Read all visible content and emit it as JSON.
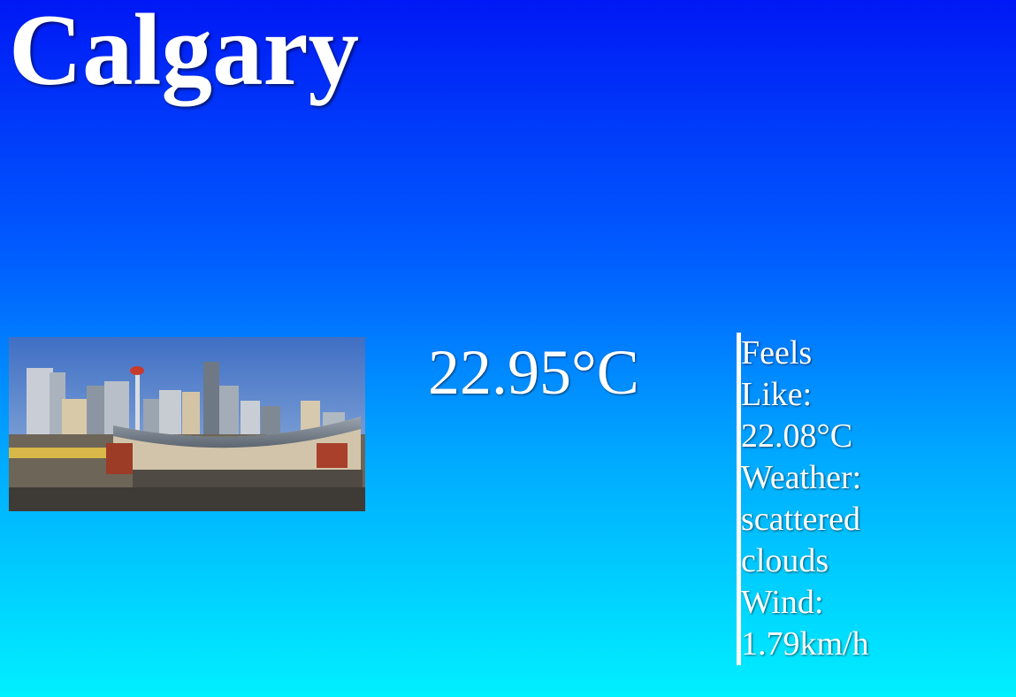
{
  "city": {
    "name": "Calgary"
  },
  "current": {
    "temperature": "22.95°C"
  },
  "details": {
    "feels_like": "Feels Like: 22.08°C",
    "weather": "Weather: scattered clouds",
    "wind": "Wind: 1.79km/h"
  },
  "photo": {
    "icon": "city-skyline-photo"
  },
  "colors": {
    "gradient_top": "#0018f5",
    "gradient_bottom": "#00f0ff",
    "text": "#ffffff"
  }
}
